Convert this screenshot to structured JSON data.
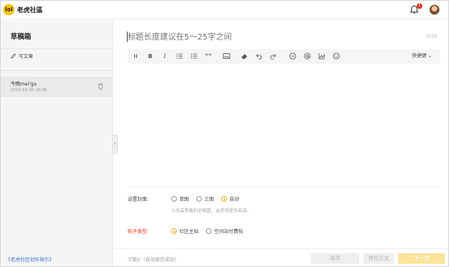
{
  "header": {
    "logo_badge": "lol",
    "logo_text": "老虎社區",
    "notification_count": "1"
  },
  "sidebar": {
    "title": "草稿箱",
    "write_label": "写文章",
    "drafts": [
      {
        "title": "今晚mei'gu",
        "time": "2020-03-09 15:05"
      }
    ],
    "guide_link": "《老虎社区创作指引》"
  },
  "editor": {
    "title_placeholder": "标题长度建议在5～25字之间",
    "title_counter": "0/30",
    "toolbar": {
      "heading": "H",
      "bold": "B",
      "italic": "I",
      "quote": "““",
      "shortcut_label": "快捷键"
    }
  },
  "settings": {
    "cover_label": "设置封面:",
    "cover_options": [
      "单图",
      "三图",
      "自动"
    ],
    "cover_selected": "自动",
    "cover_hint": "上传高质量的封面图，会获得更多阅读。",
    "post_type_label": "帖子类型:",
    "post_type_options": [
      "社区主贴",
      "空间站付费帖"
    ],
    "post_type_selected": "社区主贴"
  },
  "footer": {
    "word_count": "字数0（自动保存成功）",
    "save_label": "保存",
    "preview_label": "预览正文",
    "next_label": "下一步"
  },
  "colors": {
    "accent": "#f2b01e",
    "post_type_label": "#e5332b",
    "link": "#3a6fc7"
  }
}
